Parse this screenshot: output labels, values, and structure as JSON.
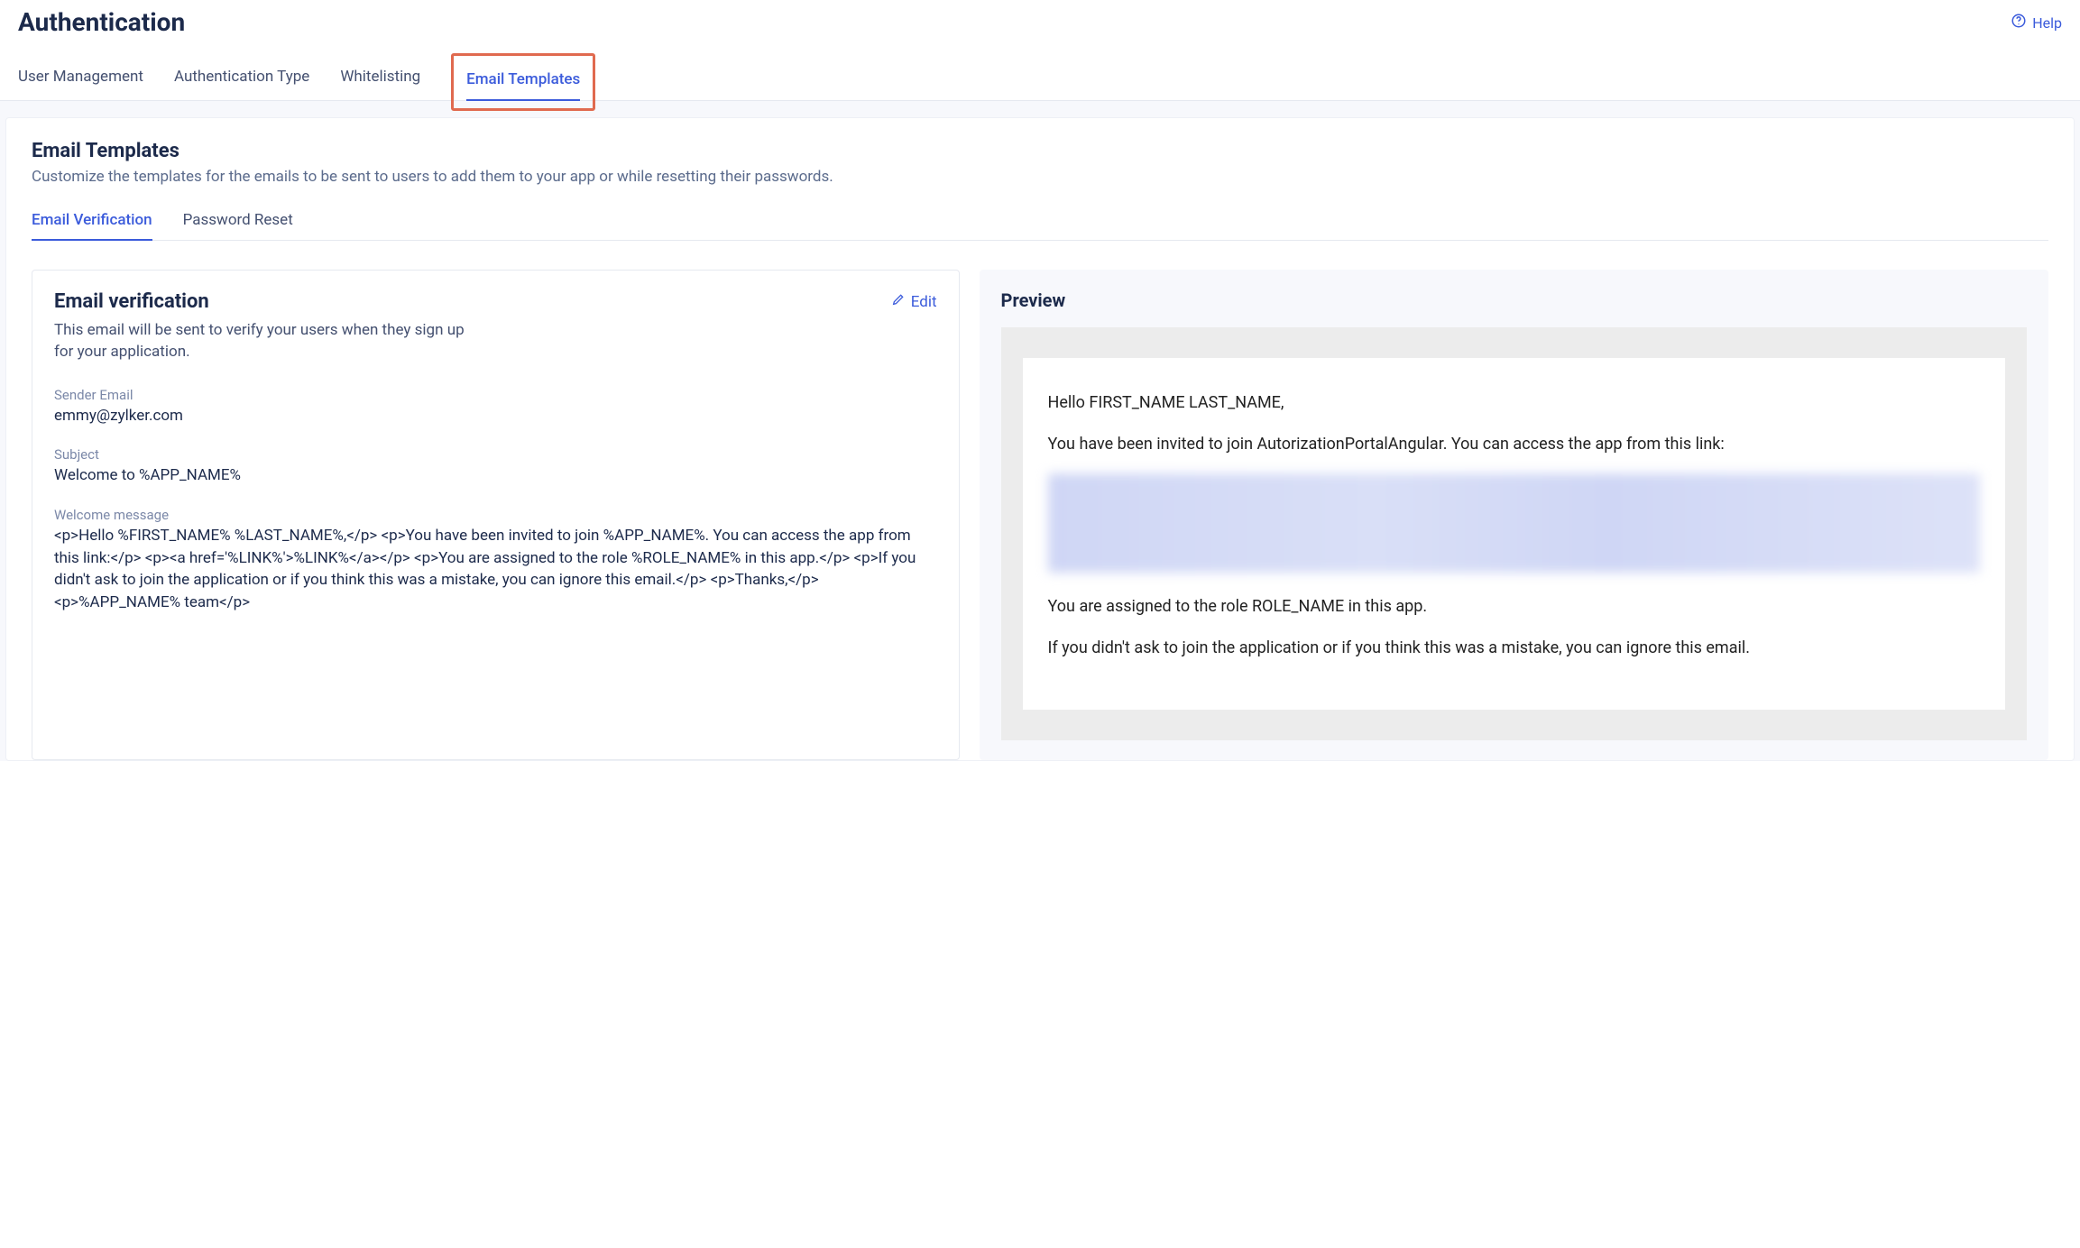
{
  "header": {
    "title": "Authentication",
    "help_label": "Help"
  },
  "main_tabs": [
    {
      "label": "User Management"
    },
    {
      "label": "Authentication Type"
    },
    {
      "label": "Whitelisting"
    },
    {
      "label": "Email Templates"
    }
  ],
  "section": {
    "title": "Email Templates",
    "desc": "Customize the templates for the emails to be sent to users to add them to your app or while resetting their passwords."
  },
  "sub_tabs": [
    {
      "label": "Email Verification"
    },
    {
      "label": "Password Reset"
    }
  ],
  "card": {
    "title": "Email verification",
    "desc": "This email will be sent to verify your users when they sign up for your application.",
    "edit_label": "Edit",
    "sender_label": "Sender Email",
    "sender_value": "emmy@zylker.com",
    "subject_label": "Subject",
    "subject_value": "Welcome to %APP_NAME%",
    "welcome_label": "Welcome message",
    "welcome_value": "<p>Hello %FIRST_NAME% %LAST_NAME%,</p> <p>You have been invited to join %APP_NAME%. You can access the app from this link:</p> <p><a href='%LINK%'>%LINK%</a></p> <p>You are assigned to the role %ROLE_NAME% in this app.</p> <p>If you didn't ask to join the application or if you think this was a mistake, you can ignore this email.</p> <p>Thanks,</p> <p>%APP_NAME% team</p>"
  },
  "preview": {
    "title": "Preview",
    "greeting": "Hello FIRST_NAME LAST_NAME,",
    "invite": "You have been invited to join AutorizationPortalAngular. You can access the app from this link:",
    "role_line": "You are assigned to the role ROLE_NAME in this app.",
    "ignore_line": "If you didn't ask to join the application or if you think this was a mistake, you can ignore this email."
  }
}
